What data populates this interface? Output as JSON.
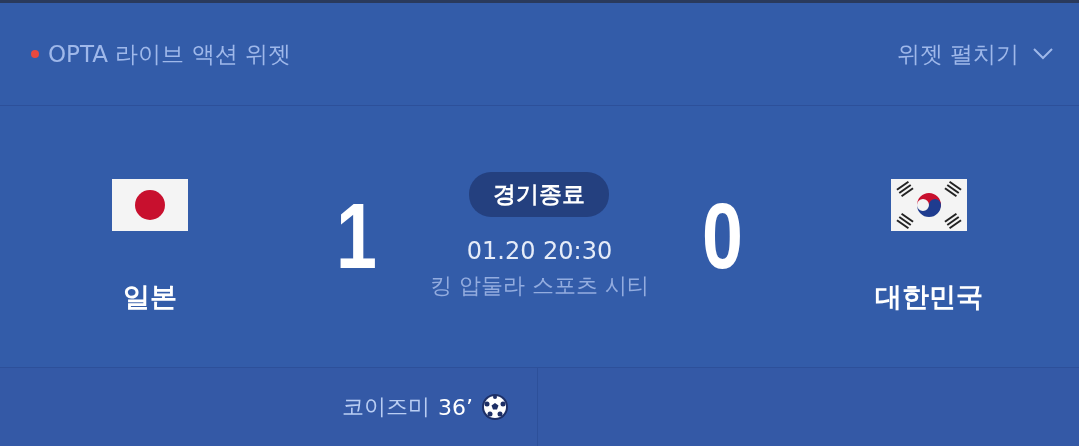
{
  "header": {
    "title": "OPTA 라이브 액션 위젯",
    "live": true,
    "expand_label": "위젯 펼치기"
  },
  "match": {
    "status": "경기종료",
    "datetime": "01.20 20:30",
    "venue": "킹 압둘라 스포츠 시티",
    "home": {
      "name": "일본",
      "score": "1"
    },
    "away": {
      "name": "대한민국",
      "score": "0"
    }
  },
  "goals": {
    "home": [
      {
        "scorer": "코이즈미",
        "minute": "36’"
      }
    ]
  }
}
